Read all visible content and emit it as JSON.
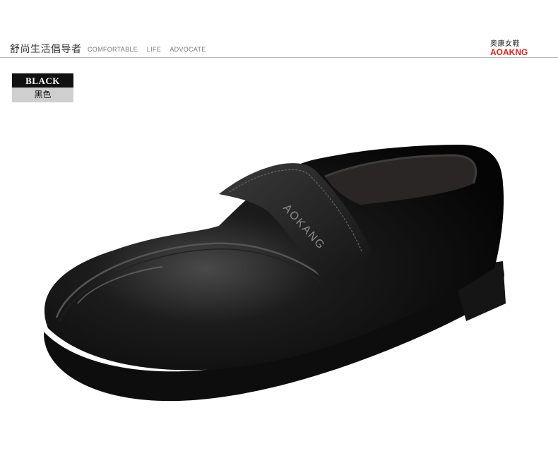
{
  "header": {
    "tagline": "舒尚生活倡导者",
    "nav": [
      "COMFORTABLE",
      "LIFE",
      "ADVOCATE"
    ],
    "brand_cn": "奥康女鞋",
    "brand_en": "AOAKNG"
  },
  "color_label": {
    "en": "BLACK",
    "cn": "黑色"
  },
  "product": {
    "strap_logo": "AOKANG",
    "color": "#0b0b0b",
    "accent": "#e02020"
  }
}
